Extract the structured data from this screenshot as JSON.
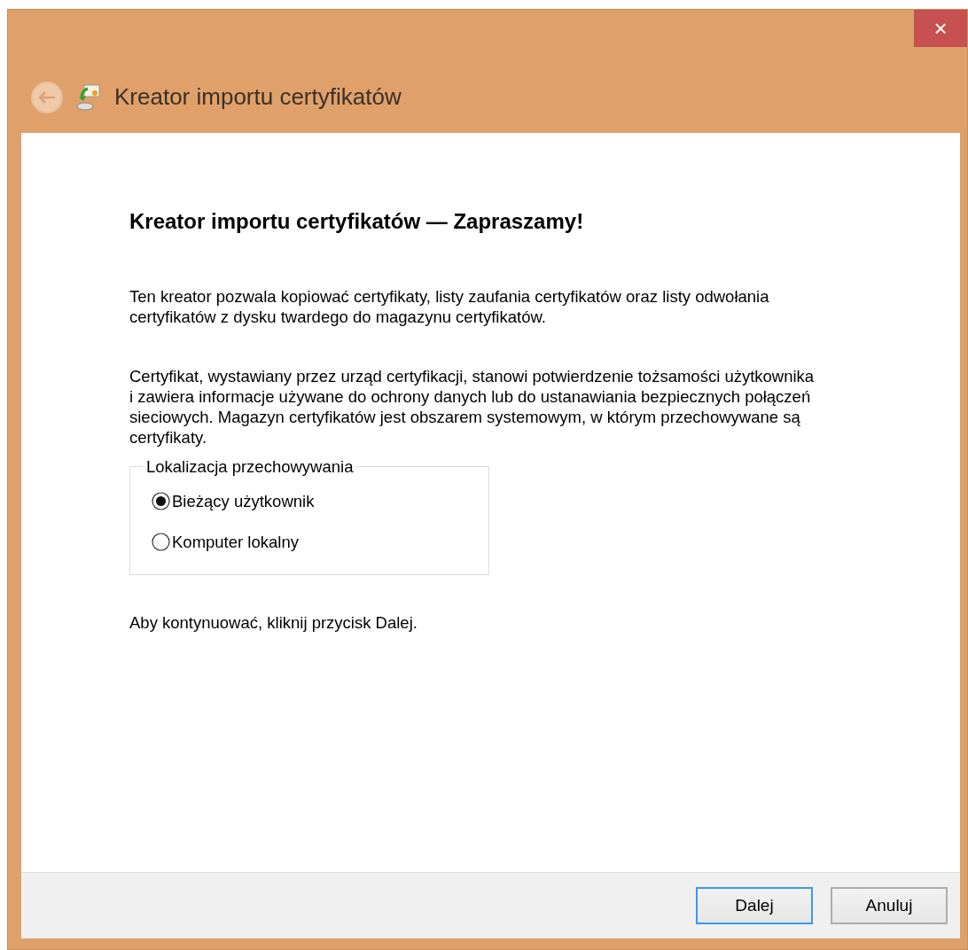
{
  "window": {
    "title": "Kreator importu certyfikatów",
    "close": "×"
  },
  "heading": "Kreator importu certyfikatów — Zapraszamy!",
  "paragraphs": [
    "Ten kreator pozwala kopiować certyfikaty, listy zaufania certyfikatów oraz listy odwołania certyfikatów z dysku twardego do magazynu certyfikatów.",
    "Certyfikat, wystawiany przez urząd certyfikacji, stanowi potwierdzenie tożsamości użytkownika i zawiera informacje używane do ochrony danych lub do ustanawiania bezpiecznych połączeń sieciowych. Magazyn certyfikatów jest obszarem systemowym, w którym przechowywane są certyfikaty."
  ],
  "store_location": {
    "legend": "Lokalizacja przechowywania",
    "options": [
      {
        "label": "Bieżący użytkownik",
        "selected": true
      },
      {
        "label": "Komputer lokalny",
        "selected": false
      }
    ]
  },
  "hint": "Aby kontynuować, kliknij przycisk Dalej.",
  "buttons": [
    {
      "label": "Dalej",
      "default": true
    },
    {
      "label": "Anuluj",
      "default": false
    }
  ]
}
